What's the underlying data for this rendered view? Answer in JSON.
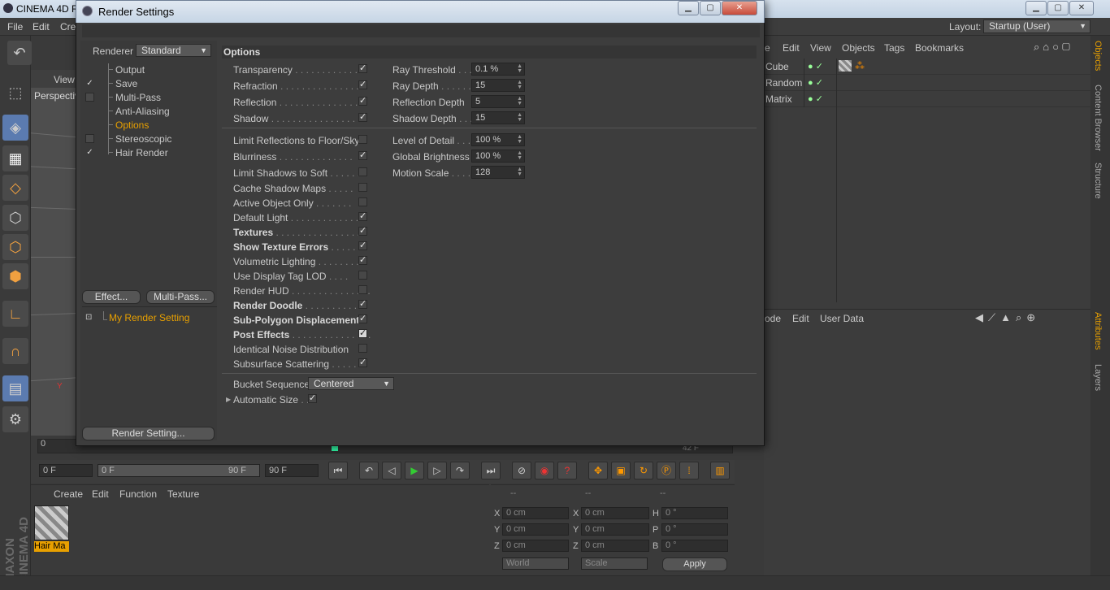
{
  "app": {
    "title": "CINEMA 4D R",
    "menu": [
      "File",
      "Edit",
      "Cre"
    ],
    "layout_label": "Layout:",
    "layout_value": "Startup (User)"
  },
  "viewport": {
    "menu_label": "View",
    "camera_label": "Perspectiv"
  },
  "timeline": {
    "ruler_start": "0",
    "ruler_end": "42 F",
    "current_frame": "0 F",
    "range_start": "0 F",
    "range_end": "90 F",
    "max_frame": "90 F"
  },
  "materials": {
    "menu": [
      "Create",
      "Edit",
      "Function",
      "Texture"
    ],
    "item_label": "Hair Ma",
    "logo_text": "MAXON CINEMA 4D"
  },
  "coordinates": {
    "header": [
      "--",
      "--",
      "--"
    ],
    "rows": [
      {
        "l1": "X",
        "v1": "0 cm",
        "l2": "X",
        "v2": "0 cm",
        "l3": "H",
        "v3": "0 °"
      },
      {
        "l1": "Y",
        "v1": "0 cm",
        "l2": "Y",
        "v2": "0 cm",
        "l3": "P",
        "v3": "0 °"
      },
      {
        "l1": "Z",
        "v1": "0 cm",
        "l2": "Z",
        "v2": "0 cm",
        "l3": "B",
        "v3": "0 °"
      }
    ],
    "mode1": "World",
    "mode2": "Scale",
    "apply": "Apply"
  },
  "objects_panel": {
    "menu": [
      "e",
      "Edit",
      "View",
      "Objects",
      "Tags",
      "Bookmarks"
    ],
    "rows": [
      "Cube",
      "Random",
      "Matrix"
    ]
  },
  "attributes_panel": {
    "menu": [
      "ode",
      "Edit",
      "User Data"
    ]
  },
  "side_tabs": [
    "Objects",
    "Content Browser",
    "Structure",
    "Attributes",
    "Layers"
  ],
  "dialog": {
    "title": "Render Settings",
    "renderer_label": "Renderer",
    "renderer_value": "Standard",
    "nav": [
      {
        "label": "Output",
        "checked": "",
        "has_box": false
      },
      {
        "label": "Save",
        "checked": "✓",
        "has_box": true
      },
      {
        "label": "Multi-Pass",
        "checked": "",
        "has_box": true
      },
      {
        "label": "Anti-Aliasing",
        "checked": "",
        "has_box": false
      },
      {
        "label": "Options",
        "checked": "",
        "has_box": false
      },
      {
        "label": "Stereoscopic",
        "checked": "",
        "has_box": true
      },
      {
        "label": "Hair Render",
        "checked": "✓",
        "has_box": true
      }
    ],
    "effect_button": "Effect...",
    "multipass_button": "Multi-Pass...",
    "render_setting_item": "My Render Setting",
    "render_setting_button": "Render Setting...",
    "section_title": "Options",
    "options_top": [
      {
        "label": "Transparency",
        "checked": "✓"
      },
      {
        "label": "Refraction",
        "checked": "✓"
      },
      {
        "label": "Reflection",
        "checked": "✓"
      },
      {
        "label": "Shadow",
        "checked": "✓"
      }
    ],
    "numbers_top": [
      {
        "label": "Ray Threshold",
        "value": "0.1 %"
      },
      {
        "label": "Ray Depth",
        "value": "15"
      },
      {
        "label": "Reflection Depth",
        "value": "5"
      },
      {
        "label": "Shadow Depth",
        "value": "15"
      }
    ],
    "options_main": [
      {
        "label": "Limit Reflections to Floor/Sky",
        "checked": "",
        "bold": false
      },
      {
        "label": "Blurriness",
        "checked": "✓",
        "bold": false
      },
      {
        "label": "Limit Shadows to Soft",
        "checked": "",
        "bold": false
      },
      {
        "label": "Cache Shadow Maps",
        "checked": "",
        "bold": false
      },
      {
        "label": "Active Object Only",
        "checked": "",
        "bold": false
      },
      {
        "label": "Default Light",
        "checked": "✓",
        "bold": false
      },
      {
        "label": "Textures",
        "checked": "✓",
        "bold": true
      },
      {
        "label": "Show Texture Errors",
        "checked": "✓",
        "bold": true
      },
      {
        "label": "Volumetric Lighting",
        "checked": "✓",
        "bold": false
      },
      {
        "label": "Use Display Tag LOD",
        "checked": "",
        "bold": false
      },
      {
        "label": "Render HUD",
        "checked": "",
        "bold": false
      },
      {
        "label": "Render Doodle",
        "checked": "✓",
        "bold": true
      },
      {
        "label": "Sub-Polygon Displacement",
        "checked": "✓",
        "bold": true
      },
      {
        "label": "Post Effects",
        "checked": "✓",
        "bold": true
      },
      {
        "label": "Identical Noise Distribution",
        "checked": "",
        "bold": false
      },
      {
        "label": "Subsurface Scattering",
        "checked": "✓",
        "bold": false
      }
    ],
    "numbers_main": [
      {
        "label": "Level of Detail",
        "value": "100 %"
      },
      {
        "label": "Global Brightness",
        "value": "100 %"
      },
      {
        "label": "Motion Scale",
        "value": "128"
      }
    ],
    "bucket_label": "Bucket Sequence",
    "bucket_value": "Centered",
    "auto_size_label": "Automatic Size",
    "auto_size_checked": "✓"
  }
}
